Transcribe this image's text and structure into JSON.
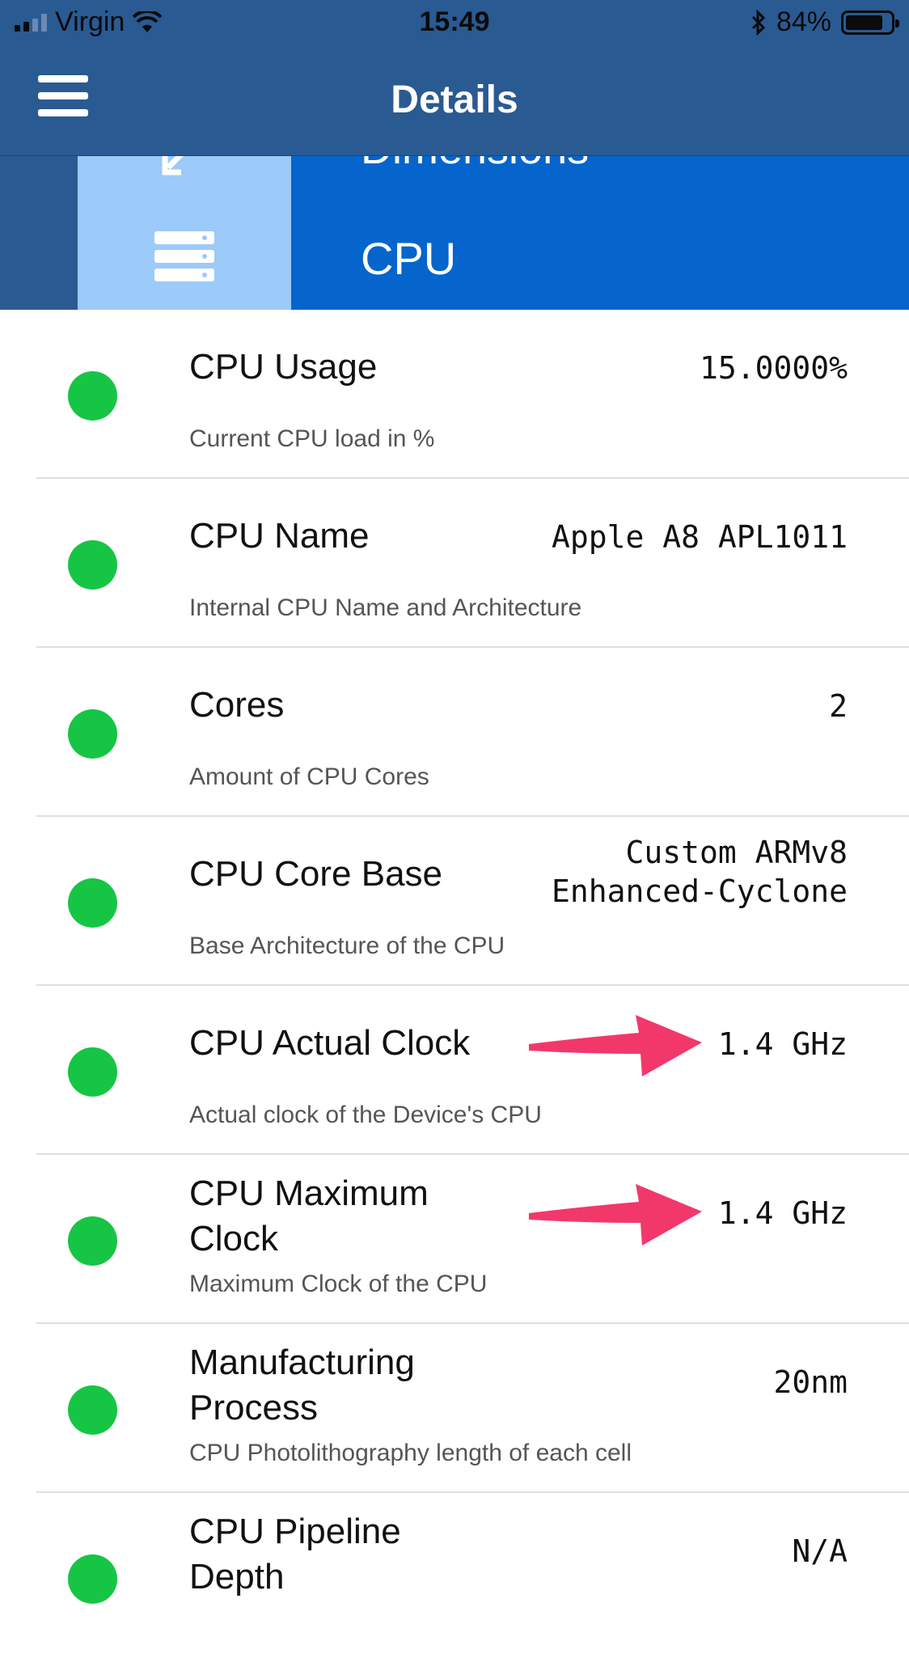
{
  "status_bar": {
    "carrier": "Virgin",
    "time": "15:49",
    "battery_percent": "84%",
    "battery_level": 0.84
  },
  "nav": {
    "title": "Details"
  },
  "category": {
    "previous_label": "Dimensions",
    "current_label": "CPU"
  },
  "rows": [
    {
      "title": "CPU Usage",
      "subtitle": "Current CPU load in %",
      "value": "15.0000%"
    },
    {
      "title": "CPU Name",
      "subtitle": "Internal CPU Name and Architecture",
      "value": "Apple A8 APL1011"
    },
    {
      "title": "Cores",
      "subtitle": "Amount of CPU Cores",
      "value": "2"
    },
    {
      "title": "CPU Core Base",
      "subtitle": "Base Architecture of the CPU",
      "value_line1": "Custom ARMv8",
      "value_line2": "Enhanced-Cyclone"
    },
    {
      "title": "CPU Actual Clock",
      "subtitle": "Actual clock of the Device's CPU",
      "value": "1.4 GHz"
    },
    {
      "title_line1": "CPU Maximum",
      "title_line2": "Clock",
      "subtitle": "Maximum Clock of the CPU",
      "value": "1.4 GHz"
    },
    {
      "title_line1": "Manufacturing",
      "title_line2": "Process",
      "subtitle": "CPU Photolithography length of each cell",
      "value": "20nm"
    },
    {
      "title_line1": "CPU Pipeline",
      "title_line2": "Depth",
      "value": "N/A"
    }
  ],
  "colors": {
    "nav_bar": "#2a5a92",
    "category_active": "#0565cc",
    "category_icon_bg": "#9ccaf9",
    "status_dot": "#17c544",
    "annotation_arrow": "#f2386a"
  }
}
